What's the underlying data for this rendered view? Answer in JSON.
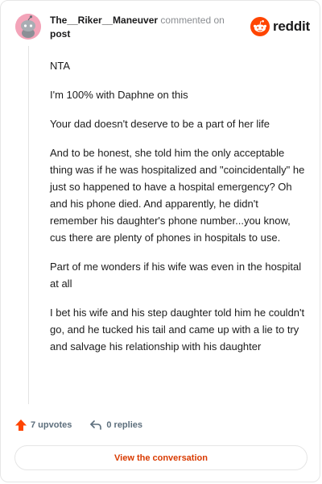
{
  "header": {
    "username": "The__Riker__Maneuver",
    "commented_text": "commented on",
    "post_link": "post"
  },
  "brand": {
    "name": "reddit",
    "accent_color": "#ff4500"
  },
  "comment": {
    "paragraphs": [
      "NTA",
      "I'm 100% with Daphne on this",
      "Your dad doesn't deserve to be a part of her life",
      "And to be honest, she told him the only acceptable thing was if he was hospitalized and \"coincidentally\" he just so happened to have a hospital emergency? Oh and his phone died. And apparently, he didn't remember his daughter's phone number...you know, cus there are plenty of phones in hospitals to use.",
      "Part of me wonders if his wife was even in the hospital at all",
      "I bet his wife and his step daughter told him he couldn't go, and he tucked his tail and came up with a lie to try and salvage his relationship with his daughter"
    ]
  },
  "footer": {
    "upvotes_label": "7 upvotes",
    "replies_label": "0 replies",
    "view_conversation_label": "View the conversation",
    "upvote_icon": "upvote-arrow-icon",
    "reply_icon": "reply-arrow-icon"
  }
}
